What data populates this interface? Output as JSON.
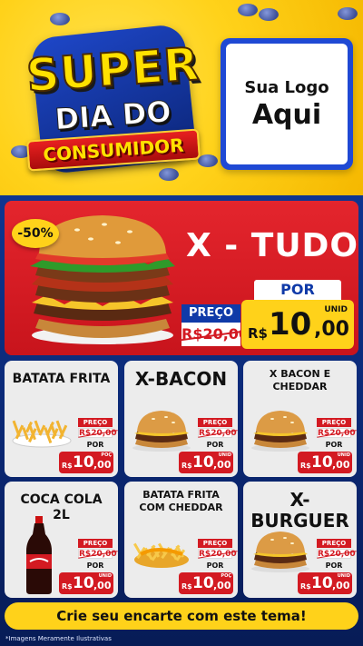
{
  "header": {
    "title_line1": "SUPER",
    "title_line2": "DIA DO",
    "title_line3": "CONSUMIDOR",
    "logo_line1": "Sua Logo",
    "logo_line2": "Aqui"
  },
  "featured": {
    "discount": "-50%",
    "name": "X - TUDO",
    "preco_label": "PREÇO",
    "old_price": "R$20,00",
    "por_label": "POR",
    "currency": "R$",
    "price_int": "10",
    "price_cents": ",00",
    "unit": "UNID"
  },
  "products": [
    {
      "name": "BATATA FRITA",
      "icon": "fries-icon",
      "preco": "PREÇO",
      "old": "R$20,00",
      "por": "POR",
      "currency": "R$",
      "int": "10",
      "cents": ",00",
      "unit": "POÇ"
    },
    {
      "name": "X-BACON",
      "icon": "burger-icon",
      "preco": "PREÇO",
      "old": "R$20,00",
      "por": "POR",
      "currency": "R$",
      "int": "10",
      "cents": ",00",
      "unit": "UNID"
    },
    {
      "name": "X BACON E CHEDDAR",
      "icon": "burger-icon",
      "preco": "PREÇO",
      "old": "R$20,00",
      "por": "POR",
      "currency": "R$",
      "int": "10",
      "cents": ",00",
      "unit": "UNID"
    },
    {
      "name": "COCA COLA 2L",
      "icon": "soda-bottle-icon",
      "preco": "PREÇO",
      "old": "R$20,00",
      "por": "POR",
      "currency": "R$",
      "int": "10",
      "cents": ",00",
      "unit": "UNID"
    },
    {
      "name": "BATATA FRITA COM CHEDDAR",
      "icon": "fries-cheddar-icon",
      "preco": "PREÇO",
      "old": "R$20,00",
      "por": "POR",
      "currency": "R$",
      "int": "10",
      "cents": ",00",
      "unit": "POÇ"
    },
    {
      "name": "X-BURGUER",
      "icon": "burger-icon",
      "preco": "PREÇO",
      "old": "R$20,00",
      "por": "POR",
      "currency": "R$",
      "int": "10",
      "cents": ",00",
      "unit": "UNID"
    }
  ],
  "cta": "Crie seu encarte com este tema!",
  "footnote": "*Imagens Meramente Ilustrativas",
  "colors": {
    "yellow": "#ffd21a",
    "red": "#d31a22",
    "blue": "#0e3590"
  }
}
